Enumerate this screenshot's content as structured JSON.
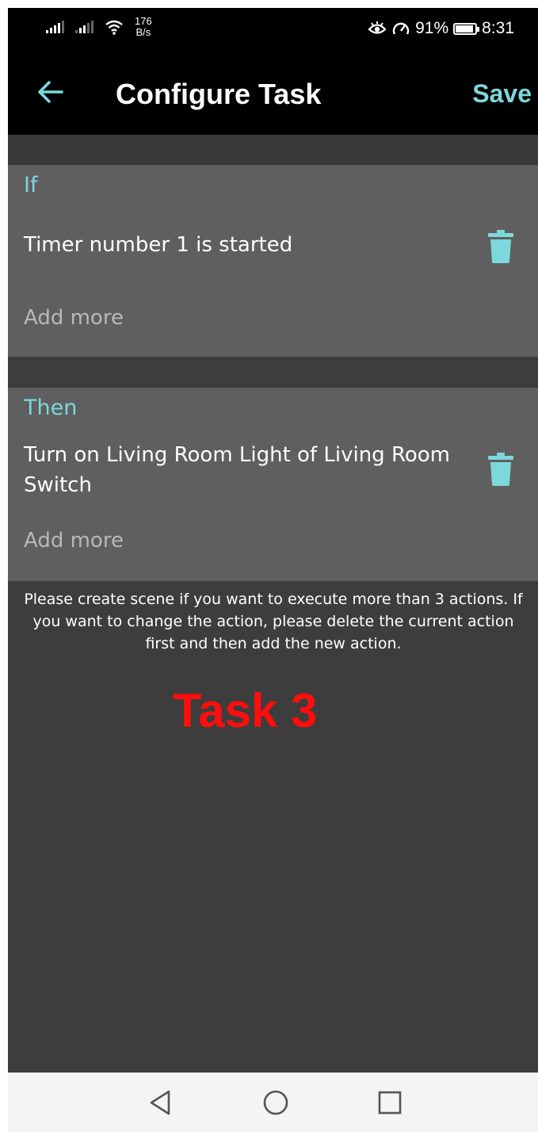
{
  "status_bar": {
    "network_speed_value": "176",
    "network_speed_unit": "B/s",
    "battery": "91%",
    "battery_level": 0.91,
    "time": "8:31",
    "icons": [
      "signal-icon",
      "signal-icon",
      "wifi-icon",
      "eye-icon",
      "speedometer-icon",
      "battery-icon"
    ]
  },
  "app_bar": {
    "back_icon": "arrow-left-icon",
    "title": "Configure Task",
    "save_label": "Save"
  },
  "if_section": {
    "label": "If",
    "condition": "Timer number 1 is started",
    "add_more": "Add more",
    "delete_icon": "trash-icon"
  },
  "then_section": {
    "label": "Then",
    "action": "Turn on Living Room Light of Living Room Switch",
    "add_more": "Add more",
    "delete_icon": "trash-icon"
  },
  "note": "Please create scene if you want to execute more than 3 actions. If you want to change the action, please delete the current action first and then add the new action.",
  "overlay_label": "Task 3",
  "navigation_bar": {
    "icons": [
      "back-triangle-icon",
      "home-circle-icon",
      "recents-square-icon"
    ]
  },
  "colors": {
    "accent": "#7dd8dc",
    "overlay_label": "#ff0d0d",
    "card_background": "#5f5f5f",
    "page_background": "#3d3d3d"
  }
}
